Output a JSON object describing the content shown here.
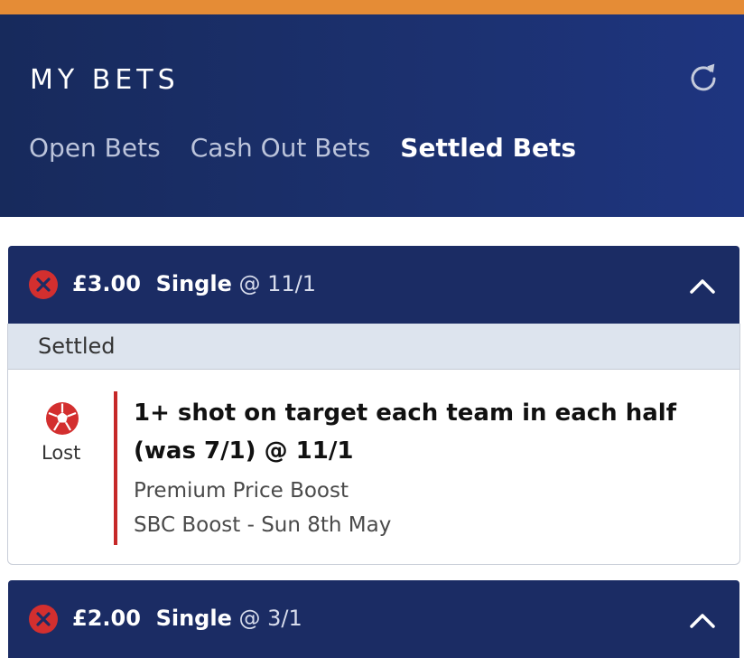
{
  "colors": {
    "top_bar": "#e58c36",
    "header_bg": "#1c3170",
    "bet_header_bg": "#1b2c64",
    "lost_icon_red": "#d32f2f",
    "divider_red": "#c62828",
    "status_bar_bg": "#dde4ee"
  },
  "header": {
    "title": "MY BETS",
    "refresh_icon": "refresh-icon"
  },
  "tabs": [
    {
      "label": "Open Bets",
      "active": false
    },
    {
      "label": "Cash Out Bets",
      "active": false
    },
    {
      "label": "Settled Bets",
      "active": true
    }
  ],
  "bets": [
    {
      "result_icon": "lost-x-icon",
      "stake": "£3.00",
      "type": "Single",
      "odds": "@ 11/1",
      "expanded": true,
      "toggle_icon": "chevron-up-icon",
      "status": "Settled",
      "selection": {
        "sport_icon": "football-icon",
        "result": "Lost",
        "title": "1+ shot on target each team in each half (was 7/1) @ 11/1",
        "market": "Premium Price Boost",
        "event": "SBC Boost - Sun 8th May"
      }
    },
    {
      "result_icon": "lost-x-icon",
      "stake": "£2.00",
      "type": "Single",
      "odds": "@ 3/1",
      "expanded": true,
      "toggle_icon": "chevron-up-icon"
    }
  ]
}
